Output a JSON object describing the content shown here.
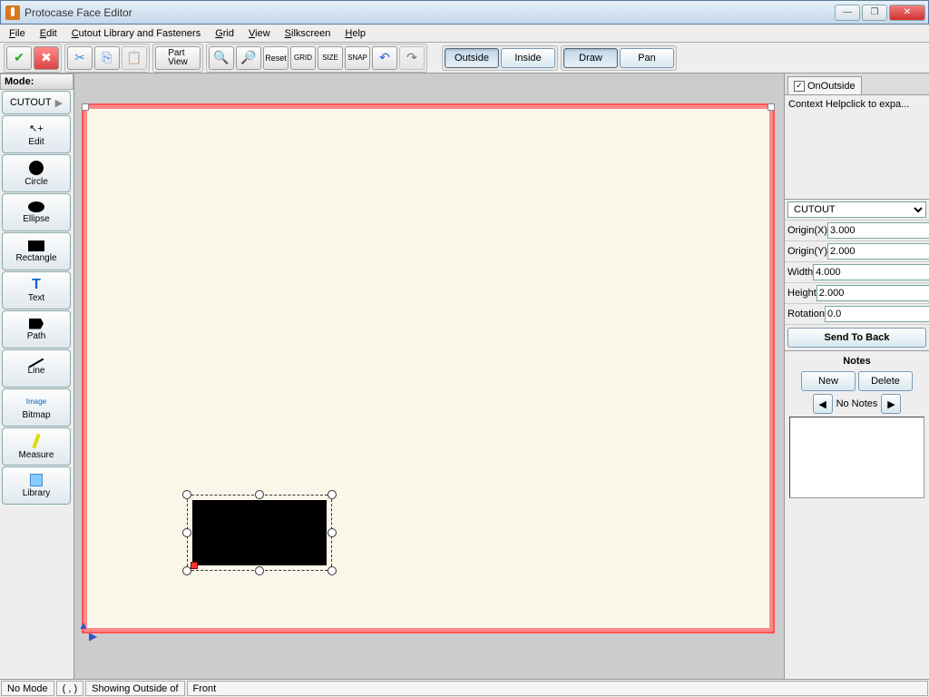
{
  "window": {
    "title": "Protocase Face Editor"
  },
  "menus": [
    "File",
    "Edit",
    "Cutout Library and Fasteners",
    "Grid",
    "View",
    "Silkscreen",
    "Help"
  ],
  "toolbar": {
    "partview": "Part\nView",
    "outside": "Outside",
    "inside": "Inside",
    "draw": "Draw",
    "pan": "Pan"
  },
  "left": {
    "mode_label": "Mode:",
    "current": "CUTOUT",
    "tools": [
      "Edit",
      "Circle",
      "Ellipse",
      "Rectangle",
      "Text",
      "Path",
      "Line",
      "Bitmap",
      "Measure",
      "Library"
    ]
  },
  "right": {
    "tab": "OnOutside",
    "help": "Context Helpclick to expa...",
    "type": "CUTOUT",
    "props": {
      "Origin(X)": "3.000",
      "Origin(Y)": "2.000",
      "Width": "4.000",
      "Height": "2.000",
      "Rotation": "0.0"
    },
    "sendtoback": "Send To Back",
    "notes": "Notes",
    "new": "New",
    "delete": "Delete",
    "nonotes": "No Notes"
  },
  "status": {
    "mode": "No Mode",
    "coords": "( , )",
    "showing": "Showing Outside of",
    "face": "Front"
  }
}
